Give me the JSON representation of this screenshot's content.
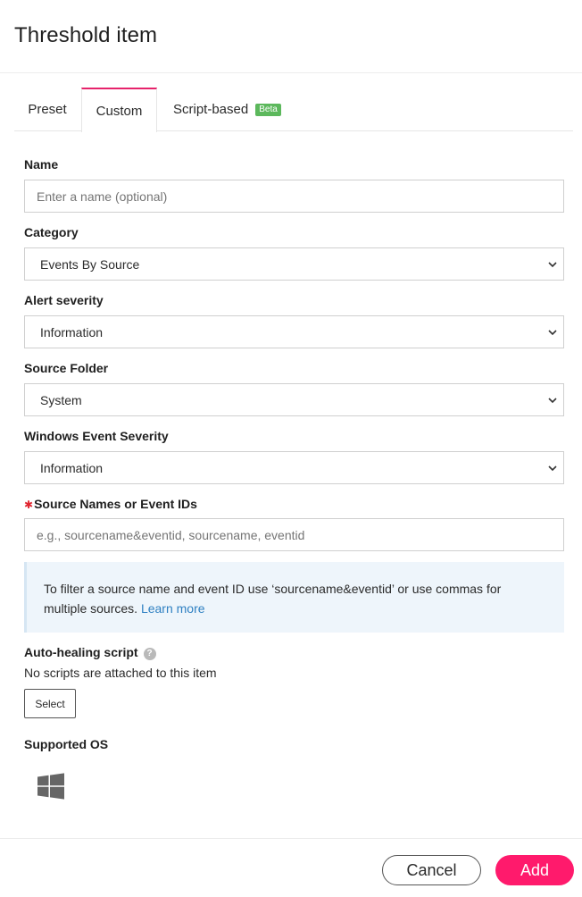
{
  "dialog": {
    "title": "Threshold item"
  },
  "tabs": [
    {
      "label": "Preset"
    },
    {
      "label": "Custom"
    },
    {
      "label": "Script-based",
      "badge": "Beta"
    }
  ],
  "form": {
    "name": {
      "label": "Name",
      "value": "",
      "placeholder": "Enter a name (optional)"
    },
    "category": {
      "label": "Category",
      "value": "Events By Source"
    },
    "alert_severity": {
      "label": "Alert severity",
      "value": "Information"
    },
    "source_folder": {
      "label": "Source Folder",
      "value": "System"
    },
    "windows_event_severity": {
      "label": "Windows Event Severity",
      "value": "Information"
    },
    "source_names": {
      "label": "Source Names or Event IDs",
      "required_marker": "✱",
      "value": "",
      "placeholder": "e.g., sourcename&eventid, sourcename, eventid"
    }
  },
  "info_box": {
    "text": "To filter a source name and event ID use ‘sourcename&eventid’ or use commas for multiple sources.",
    "link": "Learn more"
  },
  "auto_healing": {
    "label": "Auto-healing script",
    "help_icon": "question-circle-icon",
    "note": "No scripts are attached to this item",
    "select_label": "Select"
  },
  "supported_os": {
    "label": "Supported OS",
    "icon": "windows-icon"
  },
  "footer": {
    "cancel_label": "Cancel",
    "add_label": "Add"
  },
  "colors": {
    "accent": "#ff1a6c",
    "tab_active_border": "#e6236b",
    "beta_badge": "#5cb85c",
    "link": "#2f80c2",
    "info_bg": "#eef5fb"
  }
}
